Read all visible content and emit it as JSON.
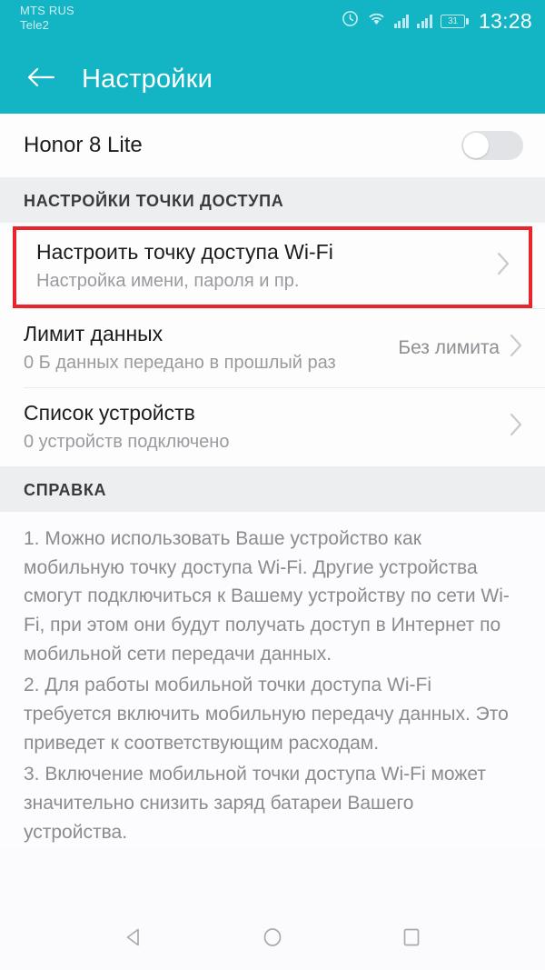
{
  "status_bar": {
    "carriers": [
      "MTS RUS",
      "Tele2"
    ],
    "time": "13:28",
    "battery_percent": "31",
    "icons": [
      "alarm-icon",
      "wifi-icon",
      "signal-icon",
      "signal-icon",
      "battery-icon"
    ]
  },
  "app_bar": {
    "back_icon": "arrow-back-icon",
    "title": "Настройки"
  },
  "hotspot_toggle": {
    "label": "Honor 8 Lite",
    "state": "off"
  },
  "sections": [
    {
      "header": "НАСТРОЙКИ ТОЧКИ ДОСТУПА",
      "items": [
        {
          "title": "Настроить точку доступа Wi-Fi",
          "subtitle": "Настройка имени, пароля и пр.",
          "value": "",
          "chevron": "chevron-right-icon",
          "highlighted": true
        },
        {
          "title": "Лимит данных",
          "subtitle": "0 Б данных передано в прошлый раз",
          "value": "Без лимита",
          "chevron": "chevron-right-icon",
          "highlighted": false
        },
        {
          "title": "Список устройств",
          "subtitle": "0 устройств подключено",
          "value": "",
          "chevron": "chevron-right-icon",
          "highlighted": false
        }
      ]
    }
  ],
  "help": {
    "header": "СПРАВКА",
    "paragraphs": [
      "1. Можно использовать Ваше устройство как мобильную точку доступа Wi-Fi. Другие устройства смогут подключиться к Вашему устройству по сети Wi-Fi, при этом они будут получать доступ в Интернет по мобильной сети передачи данных.",
      "2. Для работы мобильной точки доступа Wi-Fi требуется включить мобильную передачу данных. Это приведет к соответствующим расходам.",
      "3. Включение мобильной точки доступа Wi-Fi может значительно снизить заряд батареи Вашего устройства."
    ]
  },
  "nav_bar": {
    "back": "nav-back-icon",
    "home": "nav-home-icon",
    "recents": "nav-recents-icon"
  },
  "colors": {
    "accent": "#13b4c3",
    "highlight": "#e8252a",
    "section_bg": "#eceef0",
    "text_primary": "#1c1c1e",
    "text_secondary": "#8e8e93"
  }
}
